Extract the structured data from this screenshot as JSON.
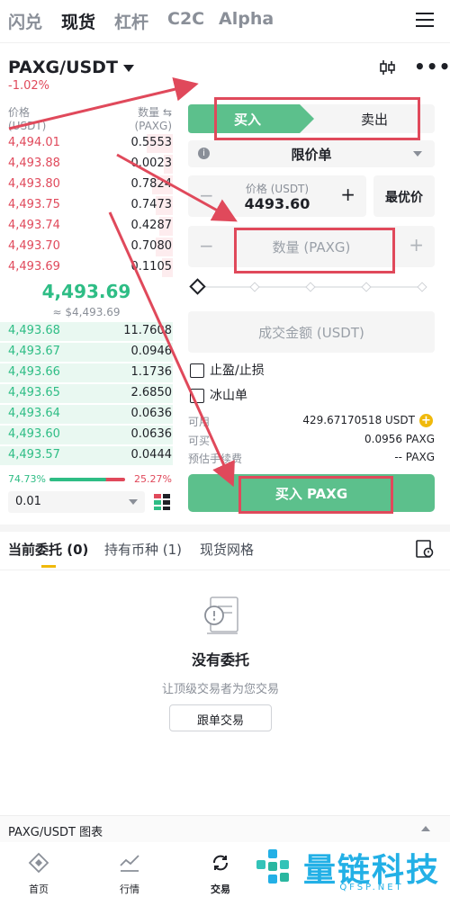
{
  "topnav": {
    "tabs": [
      "闪兑",
      "现货",
      "杠杆",
      "C2C",
      "Alpha"
    ],
    "active": 1
  },
  "pair": {
    "symbol": "PAXG/USDT",
    "change": "-1.02%"
  },
  "orderbook": {
    "price_header_1": "价格",
    "price_header_2": "(USDT)",
    "qty_header_1": "数量 ⇆",
    "qty_header_2": "(PAXG)",
    "asks": [
      {
        "price": "4,494.01",
        "qty": "0.5553",
        "depth": 0.15
      },
      {
        "price": "4,493.88",
        "qty": "0.0023",
        "depth": 0.05
      },
      {
        "price": "4,493.80",
        "qty": "0.7824",
        "depth": 0.12
      },
      {
        "price": "4,493.75",
        "qty": "0.7473",
        "depth": 0.1
      },
      {
        "price": "4,493.74",
        "qty": "0.4287",
        "depth": 0.08
      },
      {
        "price": "4,493.70",
        "qty": "0.7080",
        "depth": 0.1
      },
      {
        "price": "4,493.69",
        "qty": "0.1105",
        "depth": 0.06
      }
    ],
    "last_price": "4,493.69",
    "last_price_usd": "≈ $4,493.69",
    "bids": [
      {
        "price": "4,493.68",
        "qty": "11.7608",
        "depth": 1.0
      },
      {
        "price": "4,493.67",
        "qty": "0.0946",
        "depth": 1.0
      },
      {
        "price": "4,493.66",
        "qty": "1.1736",
        "depth": 1.0
      },
      {
        "price": "4,493.65",
        "qty": "2.6850",
        "depth": 1.0
      },
      {
        "price": "4,493.64",
        "qty": "0.0636",
        "depth": 1.0
      },
      {
        "price": "4,493.60",
        "qty": "0.0636",
        "depth": 1.0
      },
      {
        "price": "4,493.57",
        "qty": "0.0444",
        "depth": 1.0
      }
    ],
    "buy_ratio": "74.73%",
    "sell_ratio": "25.27%",
    "buy_fraction": 0.7473,
    "precision": "0.01"
  },
  "form": {
    "buy_tab": "买入",
    "sell_tab": "卖出",
    "order_type": "限价单",
    "price_label": "价格 (USDT)",
    "price_value": "4493.60",
    "best_price": "最优价",
    "qty_placeholder": "数量 (PAXG)",
    "amount_placeholder": "成交金额 (USDT)",
    "tp_sl": "止盈/止损",
    "iceberg": "冰山单",
    "available_label": "可用",
    "available_value": "429.67170518 USDT",
    "can_buy_label": "可买",
    "can_buy_value": "0.0956 PAXG",
    "fee_label": "预估手续费",
    "fee_value": "-- PAXG",
    "submit": "买入 PAXG"
  },
  "orders": {
    "tabs": [
      "当前委托 (0)",
      "持有币种 (1)",
      "现货网格"
    ],
    "empty_title": "没有委托",
    "empty_sub": "让顶级交易者为您交易",
    "copy_button": "跟单交易"
  },
  "chart_bar": {
    "label": "PAXG/USDT 图表"
  },
  "bottomnav": {
    "items": [
      "首页",
      "行情",
      "交易"
    ]
  },
  "watermark": {
    "text": "量链科技",
    "sub": "QFSP.NET"
  },
  "colors": {
    "buy": "#5cc08c",
    "sell": "#e0495b",
    "annotation": "#e0495b"
  }
}
